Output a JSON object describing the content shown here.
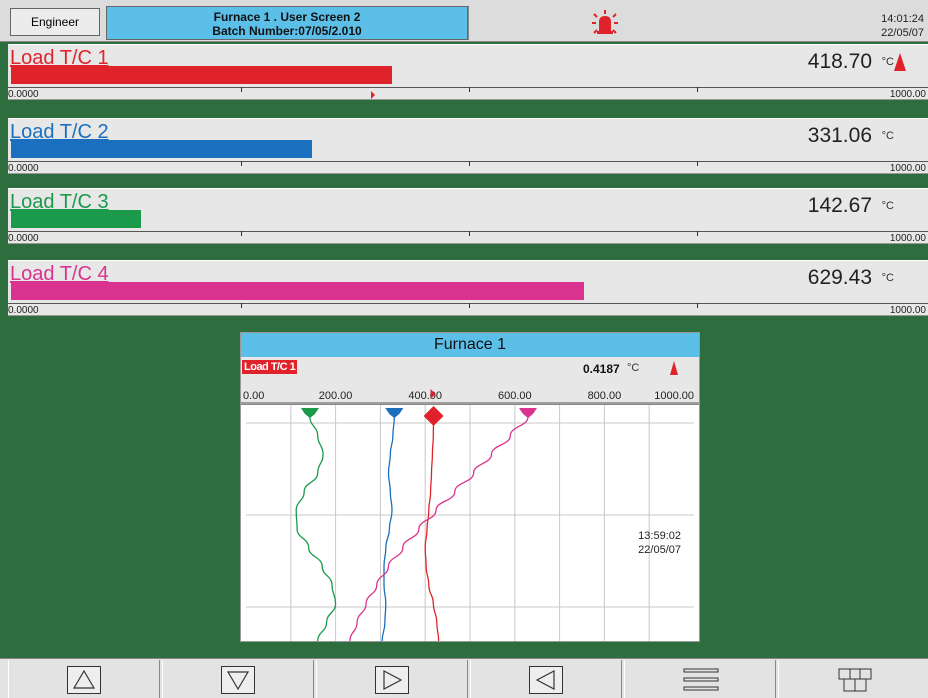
{
  "header": {
    "user_button": "Engineer",
    "title_line1": "Furnace 1 . User Screen 2",
    "title_line2": "Batch Number:07/05/2.010",
    "time": "14:01:24",
    "date": "22/05/07",
    "alarm_icon": "alarm-bell-icon",
    "alarm_color": "#e0232b"
  },
  "panels": [
    {
      "label": "Load T/C 1",
      "value": "418.70",
      "unit": "°C",
      "fraction": 0.4187,
      "color": "#e0232b",
      "scale_min": "0.0000",
      "scale_max": "1000.00",
      "alarm": true
    },
    {
      "label": "Load T/C 2",
      "value": "331.06",
      "unit": "°C",
      "fraction": 0.33106,
      "color": "#1a6fbf",
      "scale_min": "0.0000",
      "scale_max": "1000.00",
      "alarm": false
    },
    {
      "label": "Load T/C 3",
      "value": "142.67",
      "unit": "°C",
      "fraction": 0.14267,
      "color": "#1a9a4a",
      "scale_min": "0.0000",
      "scale_max": "1000.00",
      "alarm": false
    },
    {
      "label": "Load T/C 4",
      "value": "629.43",
      "unit": "°C",
      "fraction": 0.62943,
      "color": "#d9338f",
      "scale_min": "0.0000",
      "scale_max": "1000.00",
      "alarm": false
    }
  ],
  "chart_window": {
    "title": "Furnace 1",
    "tag": "Load T/C 1",
    "value": "0.4187",
    "unit": "°C",
    "scale_labels": [
      "0.00",
      "200.00",
      "400.00",
      "600.00",
      "800.00",
      "1000.00"
    ],
    "timestamp_time": "13:59:02",
    "timestamp_date": "22/05/07"
  },
  "chart_data": {
    "type": "line",
    "title": "Furnace 1",
    "xlabel": "",
    "ylabel": "",
    "xlim": [
      0,
      1000
    ],
    "orientation": "vertical-trend",
    "grid": true,
    "series": [
      {
        "name": "Load T/C 1",
        "color": "#e0232b",
        "values": [
          418.7,
          418,
          416,
          414,
          412,
          408,
          404,
          400,
          402,
          408,
          418,
          426,
          430
        ]
      },
      {
        "name": "Load T/C 2",
        "color": "#1a6fbf",
        "values": [
          331.06,
          328,
          322,
          318,
          322,
          326,
          320,
          312,
          308,
          308,
          312,
          310,
          304
        ]
      },
      {
        "name": "Load T/C 3",
        "color": "#1a9a4a",
        "values": [
          142.67,
          160,
          172,
          160,
          130,
          112,
          114,
          140,
          170,
          192,
          200,
          180,
          160
        ]
      },
      {
        "name": "Load T/C 4",
        "color": "#d9338f",
        "values": [
          629.43,
          590,
          548,
          508,
          466,
          424,
          386,
          350,
          318,
          292,
          268,
          248,
          232
        ]
      }
    ]
  },
  "bottom_buttons": [
    {
      "name": "page-up-button",
      "icon": "triangle-up-icon"
    },
    {
      "name": "page-down-button",
      "icon": "triangle-down-icon"
    },
    {
      "name": "page-right-button",
      "icon": "triangle-right-icon"
    },
    {
      "name": "page-left-button",
      "icon": "triangle-left-icon"
    },
    {
      "name": "menu-button",
      "icon": "menu-lines-icon"
    },
    {
      "name": "layout-button",
      "icon": "grid-layout-icon"
    }
  ]
}
